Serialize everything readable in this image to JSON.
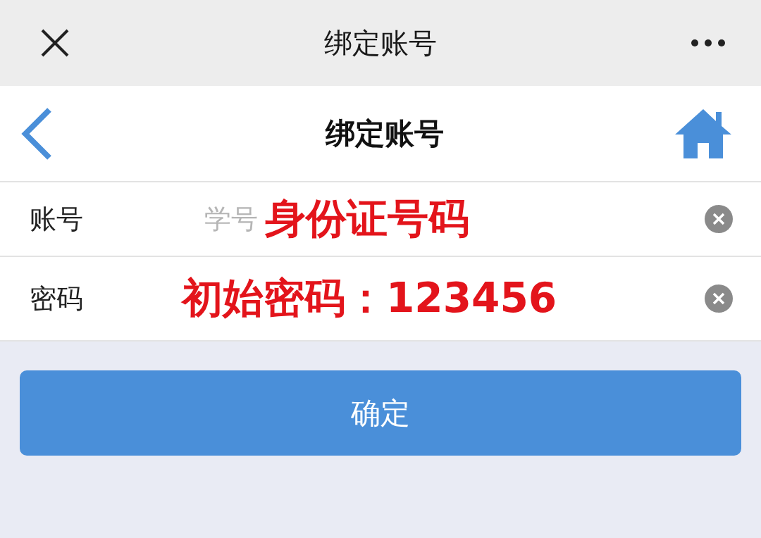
{
  "top_bar": {
    "title": "绑定账号"
  },
  "header": {
    "title": "绑定账号"
  },
  "fields": [
    {
      "label": "账号",
      "placeholder": "学号",
      "annotation": "身份证号码"
    },
    {
      "label": "密码",
      "annotation": "初始密码：123456"
    }
  ],
  "confirm_button": {
    "label": "确定"
  }
}
